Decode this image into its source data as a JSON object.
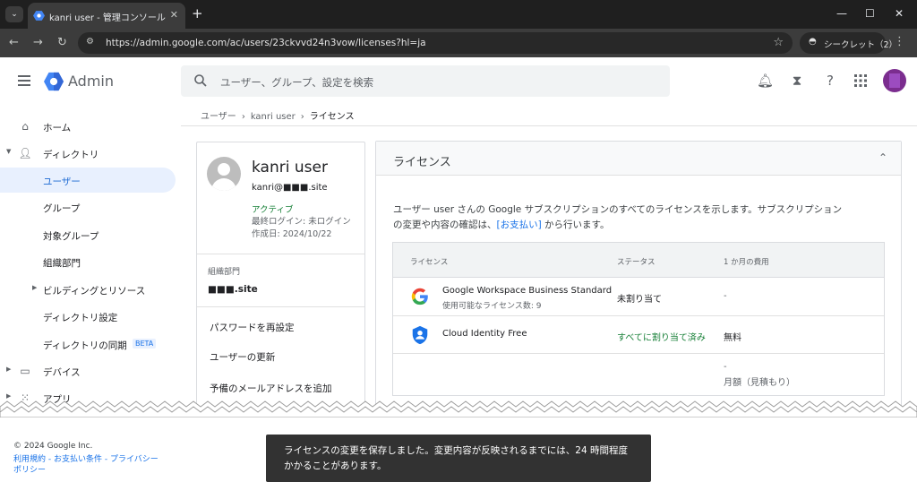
{
  "browser": {
    "tab_title": "kanri user - 管理コンソール",
    "url": "https://admin.google.com/ac/users/23ckvvd24n3vow/licenses?hl=ja",
    "incognito_label": "シークレット（2）"
  },
  "header": {
    "app_name": "Admin",
    "search_placeholder": "ユーザー、グループ、設定を検索"
  },
  "sidebar": {
    "items": [
      {
        "label": "ホーム"
      },
      {
        "label": "ディレクトリ"
      },
      {
        "label": "ユーザー"
      },
      {
        "label": "グループ"
      },
      {
        "label": "対象グループ"
      },
      {
        "label": "組織部門"
      },
      {
        "label": "ビルディングとリソース"
      },
      {
        "label": "ディレクトリ設定"
      },
      {
        "label": "ディレクトリの同期",
        "badge": "BETA"
      },
      {
        "label": "デバイス"
      },
      {
        "label": "アプリ"
      }
    ]
  },
  "breadcrumb": {
    "items": [
      "ユーザー",
      "kanri user",
      "ライセンス"
    ]
  },
  "user": {
    "name": "kanri user",
    "email": "kanri@■■■.site",
    "status": "アクティブ",
    "last_login": "最終ログイン: 未ログイン",
    "created": "作成日: 2024/10/22",
    "org_label": "組織部門",
    "org_value": "■■■.site",
    "actions": [
      "パスワードを再設定",
      "ユーザーの更新",
      "予備のメールアドレスを追加"
    ]
  },
  "licenses": {
    "title": "ライセンス",
    "description_1": "ユーザー user さんの Google サブスクリプションのすべてのライセンスを示します。サブスクリプション",
    "description_2a": "の変更や内容の確認は、",
    "description_link": "[お支払い]",
    "description_2b": " から行います。",
    "columns": [
      "ライセンス",
      "ステータス",
      "1 か月の費用"
    ],
    "rows": [
      {
        "name": "Google Workspace Business Standard",
        "sub": "使用可能なライセンス数: 9",
        "status": "未割り当て",
        "cost": "-"
      },
      {
        "name": "Cloud Identity Free",
        "sub": "",
        "status": "すべてに割り当て済み",
        "cost": "無料"
      }
    ],
    "total_cost": "-",
    "total_label": "月額（見積もり）"
  },
  "footer": {
    "copyright": "© 2024 Google Inc.",
    "links_line1": "利用規約 - お支払い条件 - プライバシー",
    "links_line2": "ポリシー"
  },
  "toast": {
    "message": "ライセンスの変更を保存しました。変更内容が反映されるまでには、24 時間程度かかることがあります。"
  },
  "colors": {
    "accent": "#1a73e8",
    "active_nav_bg": "#e8f0fe",
    "success_green": "#188038",
    "toast_bg": "#323232"
  }
}
